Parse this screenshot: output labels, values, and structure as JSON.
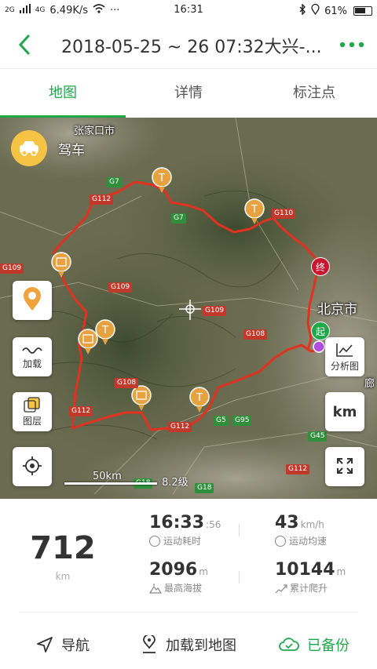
{
  "status": {
    "network_left": "2G",
    "network_right": "4G",
    "speed": "6.49K/s",
    "dots": "···",
    "time": "16:31",
    "battery": "61%"
  },
  "header": {
    "title": "2018-05-25 ~ 26 07:32大兴-..."
  },
  "tabs": [
    {
      "label": "地图"
    },
    {
      "label": "详情"
    },
    {
      "label": "标注点"
    }
  ],
  "map": {
    "drive_label": "驾车",
    "load_label": "加载",
    "layers_label": "图层",
    "analysis_label": "分析图",
    "unit_toggle": "km",
    "scale": "50km",
    "zoom_level": "8.2级",
    "start_badge": "起",
    "end_badge": "终",
    "places": {
      "zhangjiakou": "张家口市",
      "beijing": "北京市",
      "langfang": "廊"
    },
    "roads": [
      {
        "name": "G7"
      },
      {
        "name": "G112"
      },
      {
        "name": "G7"
      },
      {
        "name": "G110"
      },
      {
        "name": "G109"
      },
      {
        "name": "G109"
      },
      {
        "name": "G109"
      },
      {
        "name": "G108"
      },
      {
        "name": "G108"
      },
      {
        "name": "G112"
      },
      {
        "name": "G112"
      },
      {
        "name": "G5"
      },
      {
        "name": "G95"
      },
      {
        "name": "G45"
      },
      {
        "name": "G112"
      },
      {
        "name": "G18"
      },
      {
        "name": "G18"
      }
    ]
  },
  "stats": {
    "distance": "712",
    "distance_unit": "km",
    "duration_main": "16:33",
    "duration_sec": ":56",
    "duration_label": "运动耗时",
    "speed": "43",
    "speed_unit": "km/h",
    "speed_label": "运动均速",
    "altitude": "2096",
    "altitude_unit": "m",
    "altitude_label": "最高海拔",
    "climb": "10144",
    "climb_unit": "m",
    "climb_label": "累计爬升"
  },
  "bottom": {
    "navigate": "导航",
    "load_to_map": "加载到地图",
    "backed_up": "已备份"
  },
  "colors": {
    "accent": "#1fa84a",
    "route": "#e0321f"
  }
}
